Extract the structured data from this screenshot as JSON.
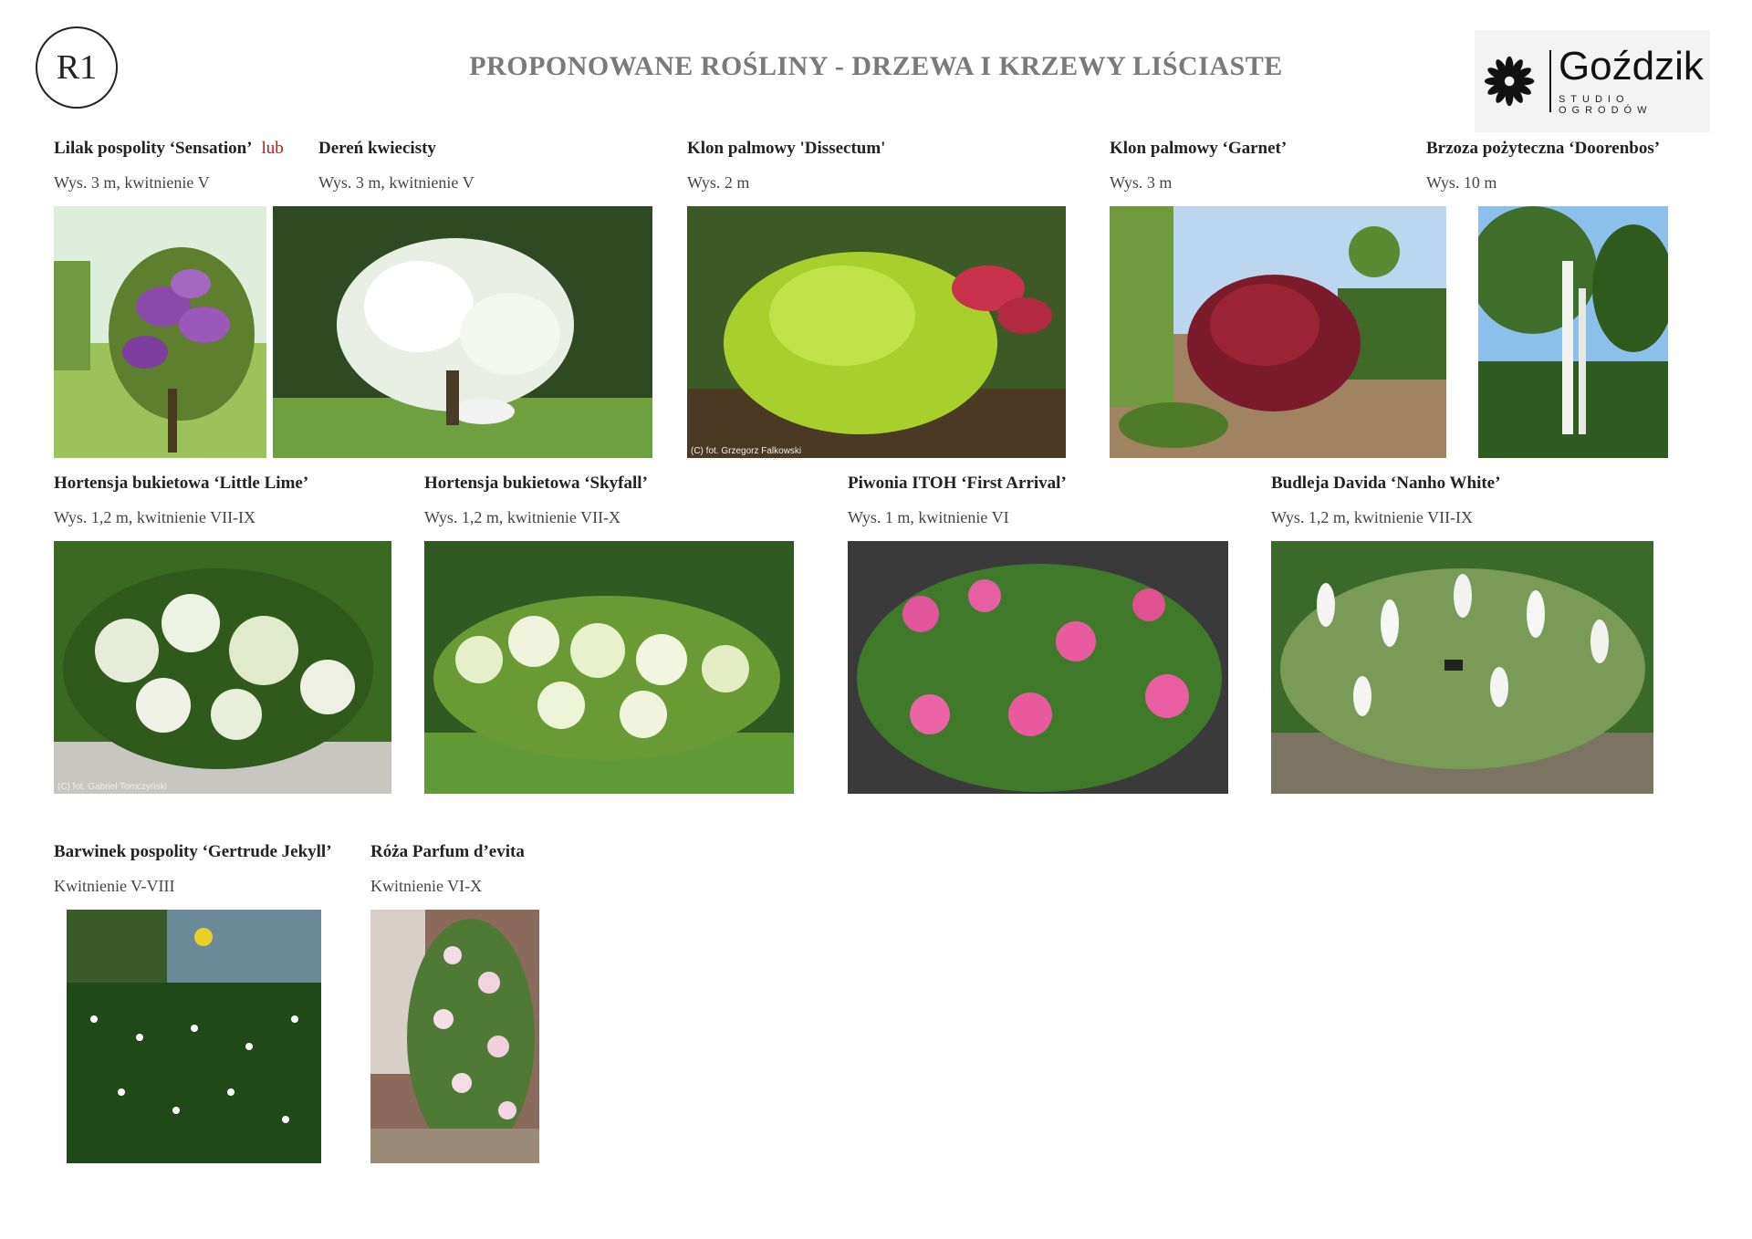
{
  "badge": "R1",
  "title": "PROPONOWANE ROŚLINY - DRZEWA I KRZEWY LIŚCIASTE",
  "logo": {
    "name": "Goździk",
    "subtitle": "STUDIO OGRODÓW"
  },
  "plants": {
    "lilak": {
      "name": "Lilak pospolity ‘Sensation’",
      "alt": "lub",
      "info": "Wys. 3 m, kwitnienie V"
    },
    "deren": {
      "name": "Dereń kwiecisty",
      "info": "Wys. 3 m, kwitnienie V"
    },
    "klon_dissectum": {
      "name": "Klon palmowy 'Dissectum'",
      "info": "Wys. 2 m",
      "credit": "(C) fot. Grzegorz Falkowski"
    },
    "klon_garnet": {
      "name": "Klon palmowy ‘Garnet’",
      "info": "Wys. 3 m"
    },
    "brzoza": {
      "name": "Brzoza pożyteczna ‘Doorenbos’",
      "info": "Wys. 10 m"
    },
    "hortensja_lime": {
      "name": "Hortensja bukietowa ‘Little Lime’",
      "info": "Wys. 1,2 m, kwitnienie VII-IX",
      "credit": "(C) fot. Gabriel Tomczyński"
    },
    "hortensja_skyfall": {
      "name": "Hortensja bukietowa ‘Skyfall’",
      "info": "Wys. 1,2 m, kwitnienie VII-X"
    },
    "piwonia": {
      "name": "Piwonia ITOH ‘First Arrival’",
      "info": "Wys. 1 m, kwitnienie VI"
    },
    "budleja": {
      "name": "Budleja Davida ‘Nanho White’",
      "info": "Wys. 1,2 m, kwitnienie VII-IX"
    },
    "barwinek": {
      "name": "Barwinek pospolity ‘Gertrude Jekyll’",
      "info": "Kwitnienie V-VIII"
    },
    "roza": {
      "name": "Róża Parfum d’evita",
      "info": "Kwitnienie VI-X"
    }
  }
}
